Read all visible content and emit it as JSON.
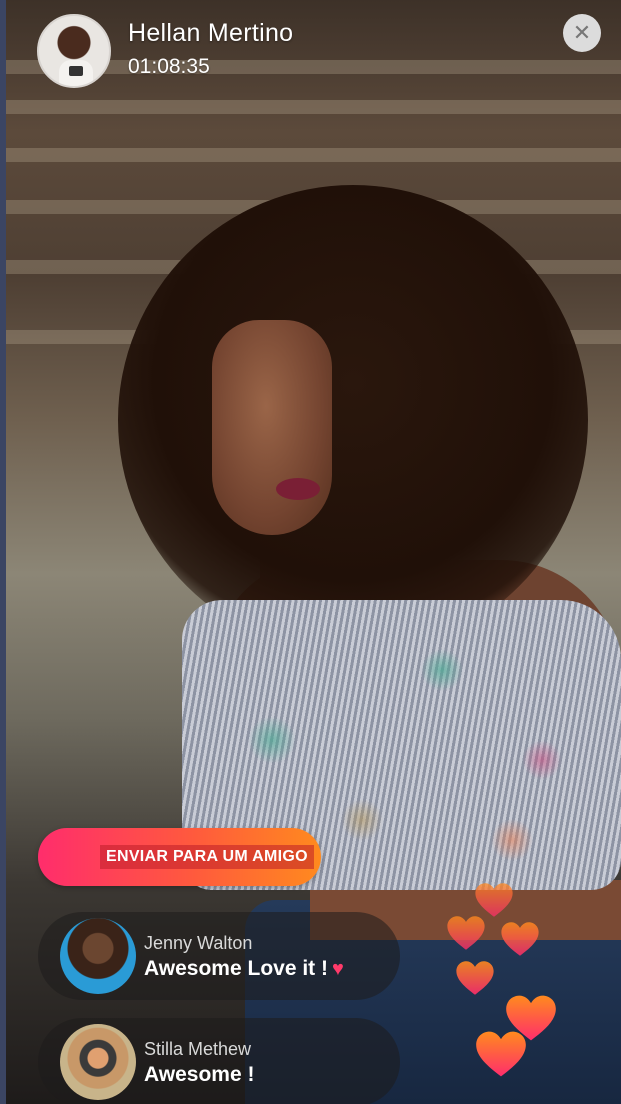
{
  "header": {
    "streamer_name": "Hellan Mertino",
    "elapsed_time": "01:08:35",
    "close_icon_glyph": "✕"
  },
  "actions": {
    "share_label": "ENVIAR PARA UM AMIGO"
  },
  "comments": [
    {
      "author": "Jenny Walton",
      "message": "Awesome Love it !",
      "has_heart": true
    },
    {
      "author": "Stilla Methew",
      "message": "Awesome !",
      "has_heart": false
    }
  ],
  "icons": {
    "heart_glyph": "♥",
    "reaction_icon": "heart-icon"
  },
  "colors": {
    "share_gradient_start": "#ff2d6c",
    "share_gradient_end": "#ff8a1e",
    "heart_top": "#ff8a1e",
    "heart_bottom": "#ff2d6c"
  }
}
